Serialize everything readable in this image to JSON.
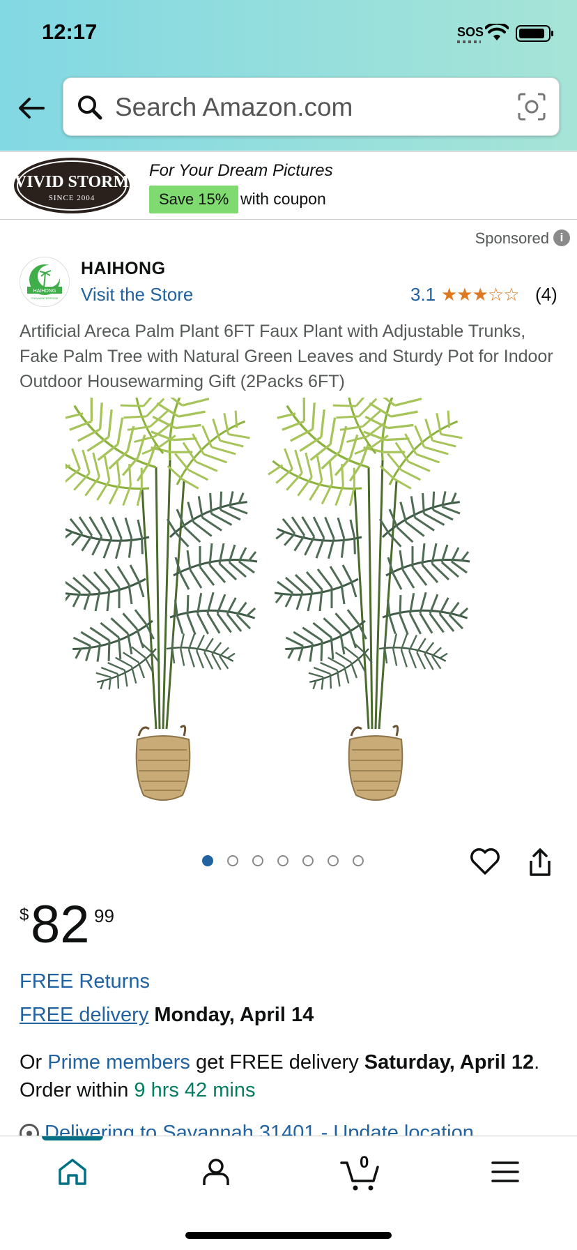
{
  "status_bar": {
    "time": "12:17",
    "sos": "SOS"
  },
  "search": {
    "placeholder": "Search Amazon.com"
  },
  "ad_banner": {
    "brand_line1": "VIVID STORM",
    "brand_line2": "SINCE 2004",
    "tagline": "For Your Dream Pictures",
    "coupon_badge": "Save 15%",
    "coupon_text": "with coupon"
  },
  "sponsored_label": "Sponsored",
  "store": {
    "name": "HAIHONG",
    "visit_link": "Visit the Store",
    "logo_text": "HAIHONG",
    "logo_subtext": "CHINA ENTERPRISE"
  },
  "rating": {
    "value": "3.1",
    "stars_filled": 3,
    "stars_total": 5,
    "count": "(4)"
  },
  "product": {
    "title": "Artificial Areca Palm Plant 6FT Faux Plant with Adjustable Trunks, Fake Palm Tree with Natural Green Leaves and Sturdy Pot for Indoor Outdoor Housewarming Gift (2Packs 6FT)"
  },
  "carousel": {
    "total": 7,
    "active_index": 0
  },
  "price": {
    "symbol": "$",
    "whole": "82",
    "fraction": "99"
  },
  "delivery": {
    "free_returns": "FREE Returns",
    "free_delivery_link": "FREE delivery",
    "free_delivery_date": "Monday, April 14",
    "prime_prefix": "Or",
    "prime_link": "Prime members",
    "prime_middle": "get FREE delivery",
    "prime_date": "Saturday, April 12",
    "prime_end": ".",
    "order_within_prefix": "Order within",
    "order_within_time": "9 hrs 42 mins",
    "location_link": "Delivering to Savannah 31401 - Update location"
  },
  "bottom_nav": {
    "cart_count": "0",
    "active": "home"
  },
  "colors": {
    "link": "#2162a1",
    "star": "#de7921",
    "coupon": "#7fda6f",
    "accent": "#007185",
    "countdown": "#067d62"
  }
}
